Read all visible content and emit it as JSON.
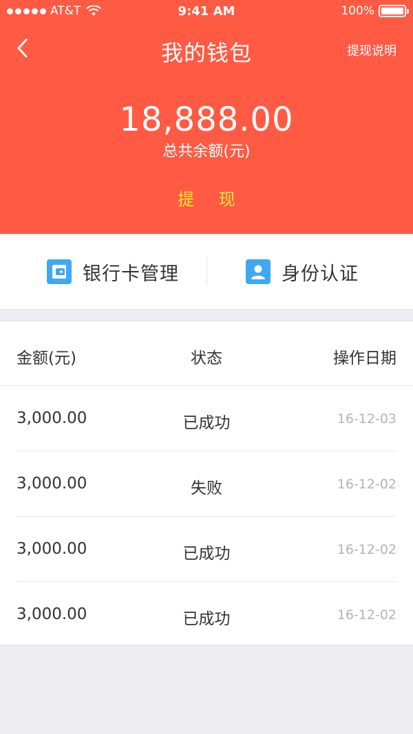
{
  "status_bar": {
    "carrier": "AT&T",
    "time": "9:41 AM",
    "battery": "100%"
  },
  "nav": {
    "title": "我的钱包",
    "right_link": "提现说明"
  },
  "balance": {
    "amount": "18,888.00",
    "label": "总共余额(元)",
    "withdraw_label": "提 现"
  },
  "actions": {
    "bank_card": "银行卡管理",
    "identity": "身份认证"
  },
  "records": {
    "columns": {
      "amount": "金额(元)",
      "status": "状态",
      "date": "操作日期"
    },
    "rows": [
      {
        "amount": "3,000.00",
        "status": "已成功",
        "date": "16-12-03"
      },
      {
        "amount": "3,000.00",
        "status": "失败",
        "date": "16-12-02"
      },
      {
        "amount": "3,000.00",
        "status": "已成功",
        "date": "16-12-02"
      },
      {
        "amount": "3,000.00",
        "status": "已成功",
        "date": "16-12-02"
      }
    ]
  },
  "colors": {
    "header_bg": "#ff5a44",
    "withdraw_text": "#ffea30",
    "icon_blue": "#3fa8f4"
  },
  "icons": [
    "signal-dots-icon",
    "wifi-icon",
    "battery-icon",
    "back-chevron-icon",
    "wallet-card-icon",
    "user-id-icon"
  ]
}
